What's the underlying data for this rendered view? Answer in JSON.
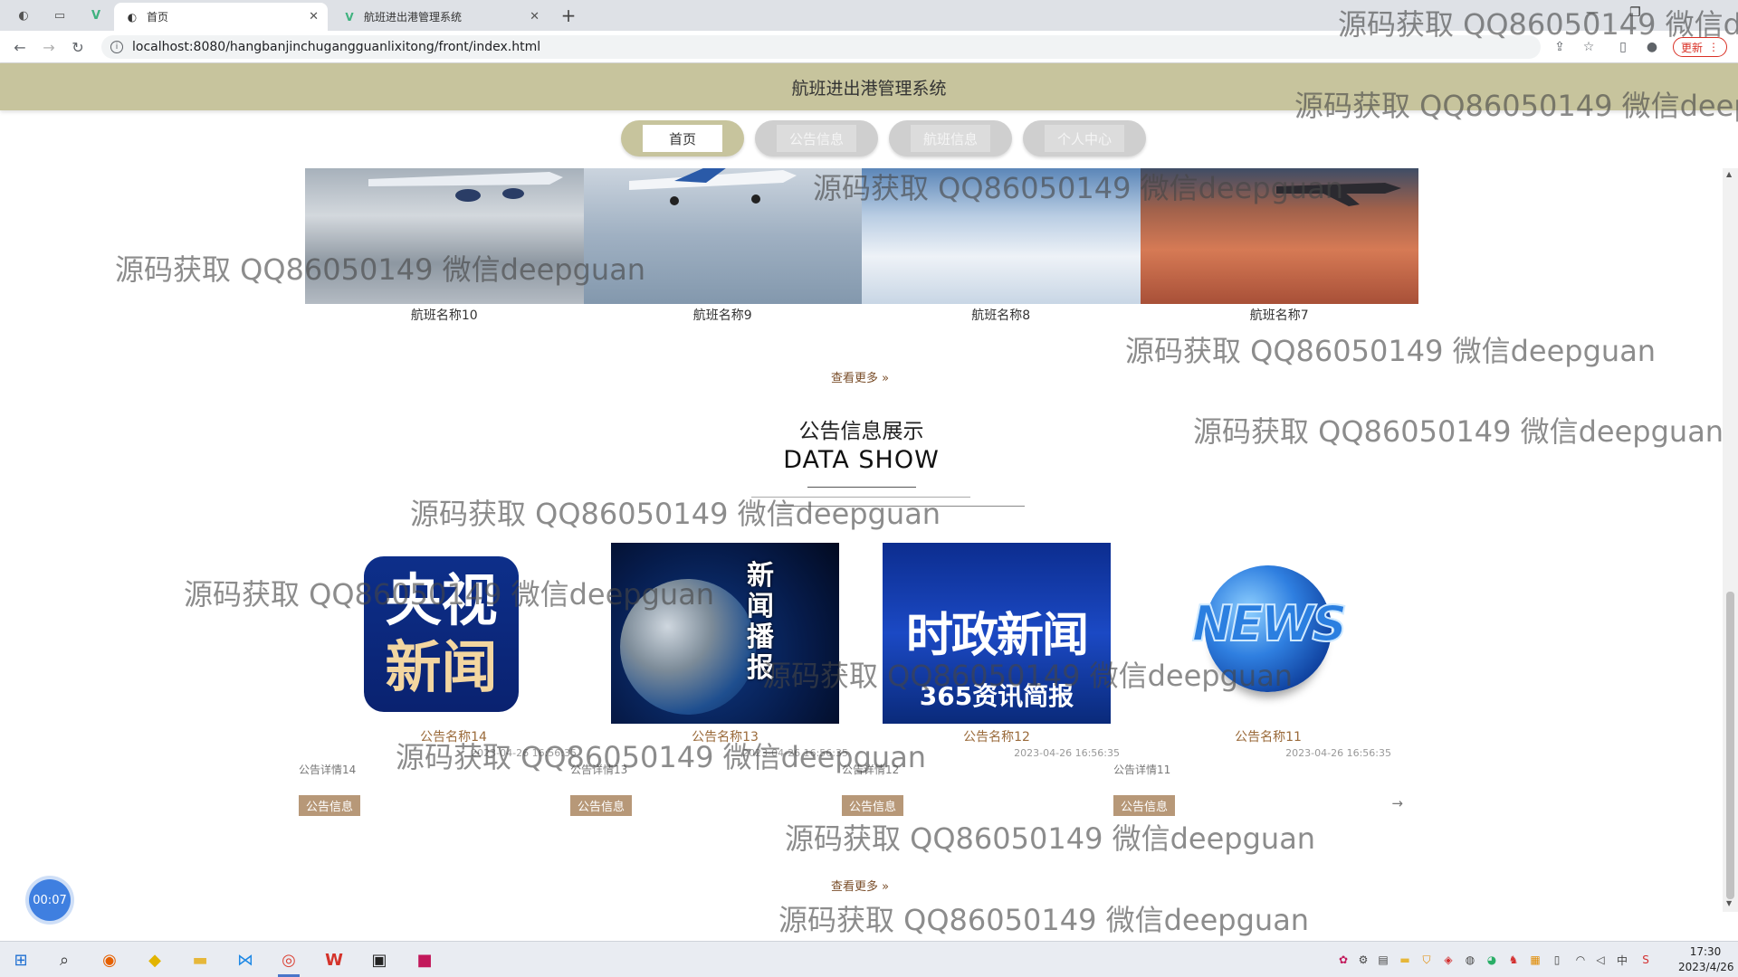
{
  "browser": {
    "tabs": [
      {
        "label": "首页",
        "favicon": "globe-icon",
        "active": true
      },
      {
        "label": "航班进出港管理系统",
        "favicon": "vue-icon",
        "active": false
      }
    ],
    "url": "localhost:8080/hangbanjinchugangguanlixitong/front/index.html",
    "update_label": "更新"
  },
  "site": {
    "title": "航班进出港管理系统",
    "nav": [
      {
        "label": "首页",
        "active": true
      },
      {
        "label": "公告信息",
        "active": false
      },
      {
        "label": "航班信息",
        "active": false
      },
      {
        "label": "个人中心",
        "active": false
      }
    ]
  },
  "flights": {
    "items": [
      {
        "name": "航班名称10",
        "image": "plane-over-clouds"
      },
      {
        "name": "航班名称9",
        "image": "plane-takeoff"
      },
      {
        "name": "航班名称8",
        "image": "clouds-sky"
      },
      {
        "name": "航班名称7",
        "image": "plane-sunset"
      }
    ],
    "more_label": "查看更多"
  },
  "notices": {
    "title_cn": "公告信息展示",
    "title_en": "DATA SHOW",
    "items": [
      {
        "name": "公告名称14",
        "date": "2023-04-26 16:56:35",
        "detail": "公告详情14",
        "badge": "公告信息",
        "image_text_1": "央视",
        "image_text_2": "新闻"
      },
      {
        "name": "公告名称13",
        "date": "2023-04-26 16:56:35",
        "detail": "公告详情13",
        "badge": "公告信息",
        "image_text_1": "新闻播报"
      },
      {
        "name": "公告名称12",
        "date": "2023-04-26 16:56:35",
        "detail": "公告详情12",
        "badge": "公告信息",
        "image_text_1": "时政新闻",
        "image_text_2": "365资讯简报"
      },
      {
        "name": "公告名称11",
        "date": "2023-04-26 16:56:35",
        "detail": "公告详情11",
        "badge": "公告信息",
        "image_text_1": "NEWS"
      }
    ],
    "more_label": "查看更多",
    "arrow": "→"
  },
  "watermark_text": "源码获取 QQ86050149 微信deepguan",
  "timer": "00:07",
  "clock": {
    "time": "17:30",
    "date": "2023/4/26"
  },
  "tray": {
    "ime": "中"
  }
}
